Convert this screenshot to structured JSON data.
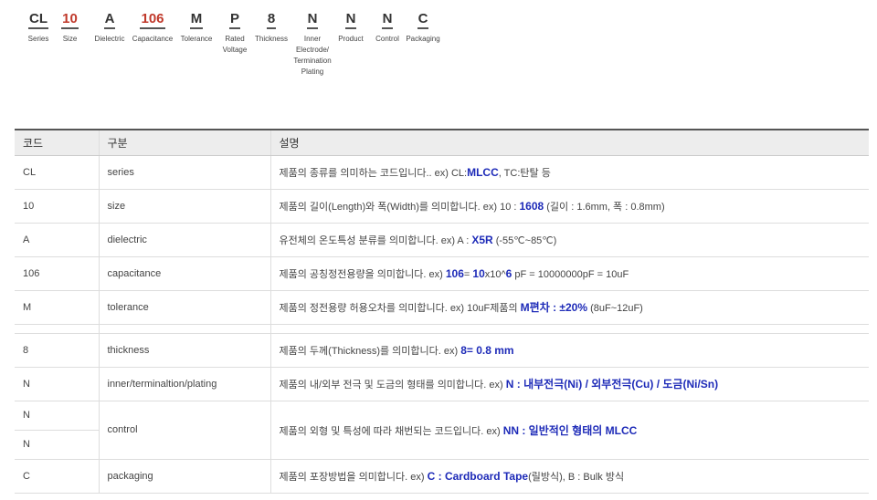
{
  "code": [
    {
      "char": "CL",
      "color": "black",
      "label": [
        "Series"
      ]
    },
    {
      "char": "10",
      "color": "red",
      "label": [
        "Size"
      ]
    },
    {
      "char": "A",
      "color": "black",
      "label": [
        "Dielectric"
      ]
    },
    {
      "char": "106",
      "color": "red",
      "label": [
        "Capacitance"
      ]
    },
    {
      "char": "M",
      "color": "black",
      "label": [
        "Tolerance"
      ]
    },
    {
      "char": "P",
      "color": "black",
      "label": [
        "Rated",
        "Voltage"
      ]
    },
    {
      "char": "8",
      "color": "black",
      "label": [
        "Thickness"
      ]
    },
    {
      "char": "N",
      "color": "black",
      "label": [
        "Inner",
        "Electrode/",
        "Termination",
        "Plating"
      ]
    },
    {
      "char": "N",
      "color": "black",
      "label": [
        "Product"
      ]
    },
    {
      "char": "N",
      "color": "black",
      "label": [
        "Control"
      ]
    },
    {
      "char": "C",
      "color": "black",
      "label": [
        "Packaging"
      ]
    }
  ],
  "colors": {
    "red": "#c0392b",
    "highlight": "#1e2bb8",
    "header_bg": "#ededed"
  },
  "table": {
    "headers": [
      "코드",
      "구분",
      "설명"
    ],
    "rows": {
      "series": {
        "code": "CL",
        "category": "series",
        "desc": [
          "제품의 종류를 의미하는 코드입니다.. ex) CL:",
          "MLCC",
          ", TC:탄탈 등"
        ]
      },
      "size": {
        "code": "10",
        "category": "size",
        "desc": [
          "제품의 길이(Length)와 폭(Width)를 의미합니다. ex) 10 : ",
          "1608",
          " (길이 : 1.6mm, 폭 : 0.8mm)"
        ]
      },
      "dielectric": {
        "code": "A",
        "category": "dielectric",
        "desc": [
          "유전체의 온도특성 분류를 의미합니다. ex) A : ",
          "X5R",
          " (-55℃~85℃)"
        ]
      },
      "capacitance": {
        "code": "106",
        "category": "capacitance",
        "desc": [
          "제품의 공칭정전용량을 의미합니다. ex) ",
          "106",
          "= ",
          "10",
          "x10^",
          "6",
          " pF = 10000000pF = 10uF"
        ]
      },
      "tolerance": {
        "code": "M",
        "category": "tolerance",
        "desc": [
          "제품의 정전용량 허용오차를 의미합니다. ex) 10uF제품의 ",
          "M편차 : ±20%",
          " (8uF~12uF)"
        ]
      },
      "thickness": {
        "code": "8",
        "category": "thickness",
        "desc": [
          "제품의 두께(Thickness)를 의미합니다. ex) ",
          "8= 0.8 mm"
        ]
      },
      "inner": {
        "code": "N",
        "category": "inner/terminaltion/plating",
        "desc": [
          "제품의 내/외부 전극 및 도금의 형태를 의미합니다. ex) ",
          "N : 내부전극(Ni) / 외부전극(Cu) / 도금(Ni/Sn)"
        ]
      },
      "control": {
        "codes": [
          "N",
          "N"
        ],
        "category": "control",
        "desc": [
          "제품의 외형 및 특성에 따라 채번되는 코드입니다. ex) ",
          "NN : 일반적인 형태의 MLCC"
        ]
      },
      "packaging": {
        "code": "C",
        "category": "packaging",
        "desc": [
          "제품의 포장방법을 의미합니다. ex) ",
          "C : Cardboard Tape",
          "(릴방식), B : Bulk 방식"
        ]
      }
    }
  }
}
